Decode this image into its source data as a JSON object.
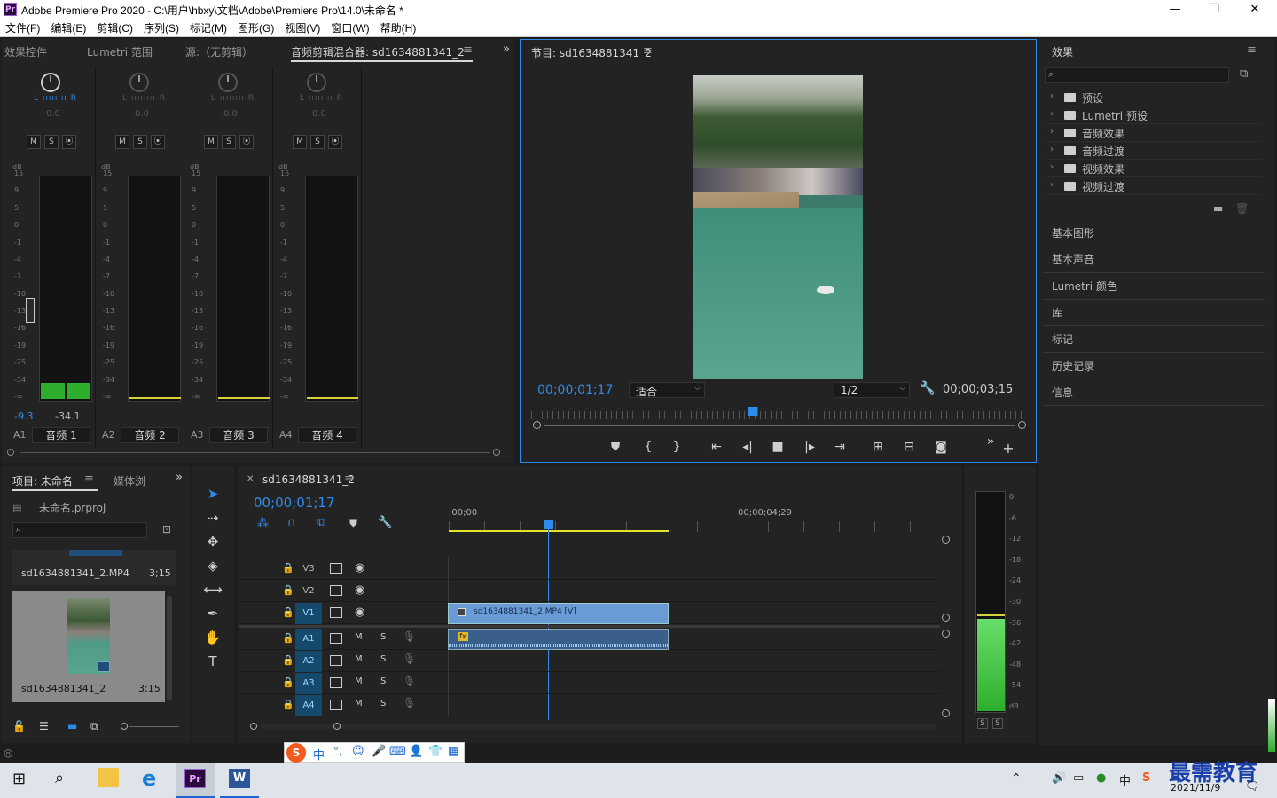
{
  "window": {
    "title": "Adobe Premiere Pro 2020 - C:\\用户\\hbxy\\文档\\Adobe\\Premiere Pro\\14.0\\未命名 *",
    "app_icon": "Pr",
    "min": "—",
    "max": "❐",
    "close": "✕"
  },
  "menu": [
    "文件(F)",
    "编辑(E)",
    "剪辑(C)",
    "序列(S)",
    "标记(M)",
    "图形(G)",
    "视图(V)",
    "窗口(W)",
    "帮助(H)"
  ],
  "left_tabs": {
    "effect_controls": "效果控件",
    "lumetri_scope": "Lumetri 范围",
    "source": "源:（无剪辑）",
    "mixer": "音频剪辑混合器: sd1634881341_2"
  },
  "mixer": {
    "channels": [
      {
        "id": "A1",
        "name": "音频 1",
        "pan": "0.0",
        "peak": "-9.3",
        "level": "-34.1"
      },
      {
        "id": "A2",
        "name": "音频 2",
        "pan": "0.0"
      },
      {
        "id": "A3",
        "name": "音频 3",
        "pan": "0.0"
      },
      {
        "id": "A4",
        "name": "音频 4",
        "pan": "0.0"
      }
    ],
    "lr": "L ıııııııı R",
    "buttons": [
      "M",
      "S",
      "⦿"
    ],
    "db_label": "dB",
    "scale": [
      "15",
      "9",
      "5",
      "0",
      "-1",
      "-4",
      "-7",
      "-10",
      "-13",
      "-16",
      "-19",
      "-25",
      "-34",
      "-∞"
    ]
  },
  "program": {
    "title": "节目: sd1634881341_2",
    "timecode": "00;00;01;17",
    "fit": "适合",
    "resolution": "1/2",
    "duration": "00;00;03;15",
    "playhead_fraction": 0.45
  },
  "effects": {
    "title": "效果",
    "items": [
      "预设",
      "Lumetri 预设",
      "音频效果",
      "音频过渡",
      "视频效果",
      "视频过渡"
    ],
    "sections": [
      "基本图形",
      "基本声音",
      "Lumetri 颜色",
      "库",
      "标记",
      "历史记录",
      "信息"
    ]
  },
  "project": {
    "tab": "项目: 未命名",
    "media_tab": "媒体浏",
    "file": "未命名.prproj",
    "clips": [
      {
        "name": "sd1634881341_2.MP4",
        "duration": "3;15"
      },
      {
        "name": "sd1634881341_2",
        "duration": "3;15"
      }
    ]
  },
  "timeline": {
    "tab": "sd1634881341_2",
    "timecode": "00;00;01;17",
    "ruler": [
      ";00;00",
      "00;00;04;29"
    ],
    "video_tracks": [
      "V3",
      "V2",
      "V1"
    ],
    "audio_tracks": [
      "A1",
      "A2",
      "A3",
      "A4"
    ],
    "clip_label": "sd1634881341_2.MP4 [V]",
    "fx": "fx"
  },
  "master_meter": {
    "scale": [
      "0",
      "-6",
      "-12",
      "-18",
      "-24",
      "-30",
      "-36",
      "-42",
      "-48",
      "-54",
      "dB"
    ],
    "solo": [
      "S",
      "S"
    ]
  },
  "ime": {
    "lang": "中",
    "punct": "°,"
  },
  "taskbar": {
    "ime": "中",
    "date": "2021/11/9",
    "watermark": "最需教育"
  }
}
